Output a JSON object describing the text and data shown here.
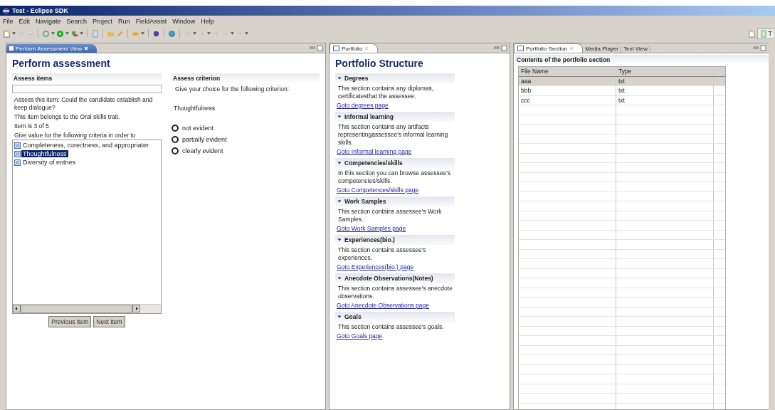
{
  "window": {
    "title": "Test - Eclipse SDK"
  },
  "menu": [
    "File",
    "Edit",
    "Navigate",
    "Search",
    "Project",
    "Run",
    "FieldAssist",
    "Window",
    "Help"
  ],
  "perspective": {
    "label": "T"
  },
  "assessment_view": {
    "tab": {
      "label": "Perform Assessment View",
      "selected": true
    },
    "title": "Perform assessment",
    "assess_items": {
      "heading": "Assess items",
      "lines": [
        "Assess this item: Could the candidate establish and keep dialogue?",
        "This item belongs to the Oral skills trait.",
        "Item is 3 of 5",
        "Give value for the following criteria in order to"
      ],
      "criteria": [
        {
          "label": "Completeness, corectness, and appropriater",
          "selected": false
        },
        {
          "label": "Thoughtfulness",
          "selected": true
        },
        {
          "label": "Diversity of entries",
          "selected": false
        }
      ],
      "buttons": [
        "Previous Item",
        "Next Item"
      ]
    },
    "assess_criterion": {
      "heading": "Assess criterion",
      "prompt": "Give your choice for the following criterion:",
      "criterion": "Thoughtfulness",
      "options": [
        {
          "label": "not evident",
          "selected": false
        },
        {
          "label": "partially evident",
          "selected": false
        },
        {
          "label": "clearly evident",
          "selected": false
        }
      ]
    }
  },
  "portfolio_view": {
    "tab": {
      "label": "Portfolio",
      "selected": true
    },
    "title": "Portfolio Structure",
    "sections": [
      {
        "heading": "Degrees",
        "expanded": true,
        "text": "This section contains any diplomas, certificatesthat the assessee.",
        "link": "Goto degrees page"
      },
      {
        "heading": "Informal learning",
        "expanded": true,
        "text": "This section contains any artifacts representingassessee's informal learning skills.",
        "link": "Goto Informal learning page"
      },
      {
        "heading": "Competencies/skills",
        "expanded": true,
        "text": "In this section you can browse assessee's competencies/skills.",
        "link": "Goto Competences/skills page"
      },
      {
        "heading": "Work Samples",
        "expanded": true,
        "text": "This section contains assessee's Work Samples.",
        "link": "Goto Work Samples page"
      },
      {
        "heading": "Experiences(bio.)",
        "expanded": true,
        "text": "This section contains assessee's experiences.",
        "link": "Goto Experiences(bio.) page"
      },
      {
        "heading": "Anecdote Observations(Notes)",
        "expanded": true,
        "text": "This section contains assessee's anecdote observations.",
        "link": "Goto Anecdote Observations page"
      },
      {
        "heading": "Goals",
        "expanded": true,
        "text": "This section contains assessee's goals.",
        "link": "Goto Goals page"
      }
    ]
  },
  "section_view": {
    "tabs": [
      {
        "label": "Portfolio Section",
        "selected": true
      },
      {
        "label": "Media Player",
        "selected": false
      },
      {
        "label": "Text View",
        "selected": false
      }
    ],
    "heading": "Contents of the portfolio section",
    "table": {
      "columns": [
        "File Name",
        "Type"
      ],
      "rows": [
        {
          "cells": [
            "aaa",
            "txt"
          ],
          "selected": true
        },
        {
          "cells": [
            "bbb",
            "txt"
          ],
          "selected": false
        },
        {
          "cells": [
            "ccc",
            "txt"
          ],
          "selected": false
        }
      ]
    }
  }
}
